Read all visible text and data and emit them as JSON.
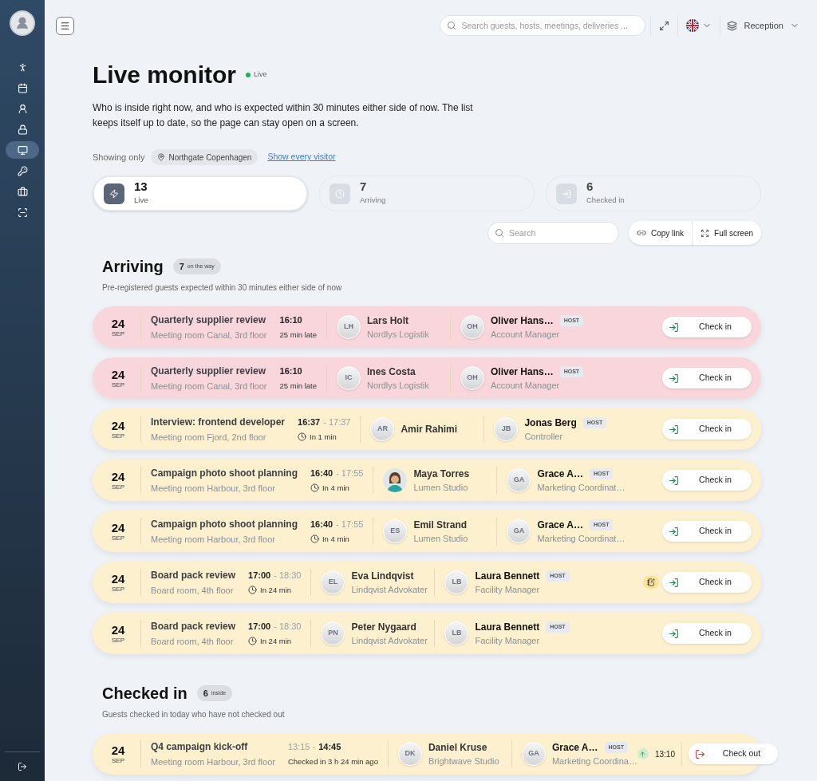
{
  "sidebar": {
    "items": [
      {
        "kind": "arrivals",
        "selected": false
      },
      {
        "kind": "calendar",
        "selected": false
      },
      {
        "kind": "contacts",
        "selected": false
      },
      {
        "kind": "lock",
        "selected": false
      },
      {
        "kind": "monitor",
        "selected": true
      },
      {
        "kind": "keys",
        "selected": false
      },
      {
        "kind": "parcels",
        "selected": false
      },
      {
        "kind": "scan",
        "selected": false
      }
    ]
  },
  "topbar": {
    "search": {
      "placeholder": "Search guests, hosts, meetings, deliveries ..."
    },
    "workspace": "Reception"
  },
  "page": {
    "title": "Live monitor",
    "status": "Live",
    "description": "Who is inside right now, and who is expected within 30 minutes either side of now. The list keeps itself up to date, so the page can stay open on a screen.",
    "filter": {
      "label": "Showing only",
      "location": "Northgate Copenhagen",
      "link": "Show every visitor"
    }
  },
  "stats": [
    {
      "kind": "live",
      "value": "13",
      "label": "Live",
      "selected": true
    },
    {
      "kind": "arriving",
      "value": "7",
      "label": "Arriving",
      "selected": false
    },
    {
      "kind": "checked_in",
      "value": "6",
      "label": "Checked in",
      "selected": false
    }
  ],
  "tools": {
    "search": {
      "placeholder": "Search"
    },
    "buttons": [
      {
        "kind": "link",
        "label": "Copy link"
      },
      {
        "kind": "fullscreen",
        "label": "Full screen"
      }
    ]
  },
  "sections": [
    {
      "title": "Arriving",
      "count": "7",
      "count_label": "on the way",
      "subtitle": "Pre-registered guests expected within 30 minutes either side of now",
      "rows": [
        {
          "kind": "late",
          "day": "24",
          "month": "SEP",
          "title": "Quarterly supplier review",
          "room": "Meeting room Canal, 3rd floor",
          "start": "16:10",
          "timing": "25 min late",
          "guest": {
            "kind": "initials",
            "initials": "LH",
            "name": "Lars Holt",
            "company": "Nordlys Logistik"
          },
          "host": {
            "initials": "OH",
            "name": "Oliver Hans…",
            "badge": "HOST",
            "role": "Account Manager"
          },
          "note": false,
          "action": {
            "kind": "check_in",
            "label": "Check in"
          }
        },
        {
          "kind": "late",
          "day": "24",
          "month": "SEP",
          "title": "Quarterly supplier review",
          "room": "Meeting room Canal, 3rd floor",
          "start": "16:10",
          "timing": "25 min late",
          "guest": {
            "kind": "initials",
            "initials": "IC",
            "name": "Ines Costa",
            "company": "Nordlys Logistik"
          },
          "host": {
            "initials": "OH",
            "name": "Oliver Hans…",
            "badge": "HOST",
            "role": "Account Manager"
          },
          "note": false,
          "action": {
            "kind": "check_in",
            "label": "Check in"
          }
        },
        {
          "kind": "upcoming",
          "day": "24",
          "month": "SEP",
          "title": "Interview: frontend developer",
          "room": "Meeting room Fjord, 2nd floor",
          "start": "16:37",
          "end": "- 17:37",
          "timing": "In 1 min",
          "guest": {
            "kind": "initials",
            "initials": "AR",
            "name": "Amir Rahimi"
          },
          "host": {
            "initials": "JB",
            "name": "Jonas Berg",
            "badge": "HOST",
            "role": "Controller"
          },
          "note": false,
          "action": {
            "kind": "check_in",
            "label": "Check in"
          }
        },
        {
          "kind": "upcoming",
          "day": "24",
          "month": "SEP",
          "title": "Campaign photo shoot planning",
          "room": "Meeting room Harbour, 3rd floor",
          "start": "16:40",
          "end": "- 17:55",
          "timing": "In 4 min",
          "guest": {
            "kind": "photo",
            "name": "Maya Torres",
            "company": "Lumen Studio"
          },
          "host": {
            "initials": "GA",
            "name": "Grace A…",
            "badge": "HOST",
            "role": "Marketing Coordinat…"
          },
          "note": false,
          "action": {
            "kind": "check_in",
            "label": "Check in"
          }
        },
        {
          "kind": "upcoming",
          "day": "24",
          "month": "SEP",
          "title": "Campaign photo shoot planning",
          "room": "Meeting room Harbour, 3rd floor",
          "start": "16:40",
          "end": "- 17:55",
          "timing": "In 4 min",
          "guest": {
            "kind": "initials",
            "initials": "ES",
            "name": "Emil Strand",
            "company": "Lumen Studio"
          },
          "host": {
            "initials": "GA",
            "name": "Grace A…",
            "badge": "HOST",
            "role": "Marketing Coordinat…"
          },
          "note": false,
          "action": {
            "kind": "check_in",
            "label": "Check in"
          }
        },
        {
          "kind": "upcoming",
          "day": "24",
          "month": "SEP",
          "title": "Board pack review",
          "room": "Board room, 4th floor",
          "start": "17:00",
          "end": "- 18:30",
          "timing": "In 24 min",
          "guest": {
            "kind": "initials",
            "initials": "EL",
            "name": "Eva Lindqvist",
            "company": "Lindqvist Advokater"
          },
          "host": {
            "initials": "LB",
            "name": "Laura Bennett",
            "badge": "HOST",
            "role": "Facility Manager"
          },
          "note": true,
          "action": {
            "kind": "check_in",
            "label": "Check in"
          }
        },
        {
          "kind": "upcoming",
          "day": "24",
          "month": "SEP",
          "title": "Board pack review",
          "room": "Board room, 4th floor",
          "start": "17:00",
          "end": "- 18:30",
          "timing": "In 24 min",
          "guest": {
            "kind": "initials",
            "initials": "PN",
            "name": "Peter Nygaard",
            "company": "Lindqvist Advokater"
          },
          "host": {
            "initials": "LB",
            "name": "Laura Bennett",
            "badge": "HOST",
            "role": "Facility Manager"
          },
          "note": false,
          "action": {
            "kind": "check_in",
            "label": "Check in"
          }
        }
      ]
    },
    {
      "title": "Checked in",
      "count": "6",
      "count_label": "inside",
      "subtitle": "Guests checked in today who have not checked out",
      "rows": [
        {
          "kind": "checked_in",
          "day": "24",
          "month": "SEP",
          "title": "Q4 campaign kick-off",
          "room": "Meeting room Harbour, 3rd floor",
          "start": "13:15 -",
          "end": "14:45",
          "timing": "Checked in 3 h 24 min ago",
          "guest": {
            "kind": "initials",
            "initials": "DK",
            "name": "Daniel Kruse",
            "company": "Brightwave Studio"
          },
          "host": {
            "initials": "GA",
            "name": "Grace A…",
            "badge": "HOST",
            "role": "Marketing Coordina…"
          },
          "arrived": "13:10",
          "note": false,
          "action": {
            "kind": "check_out",
            "label": "Check out"
          }
        }
      ]
    }
  ]
}
